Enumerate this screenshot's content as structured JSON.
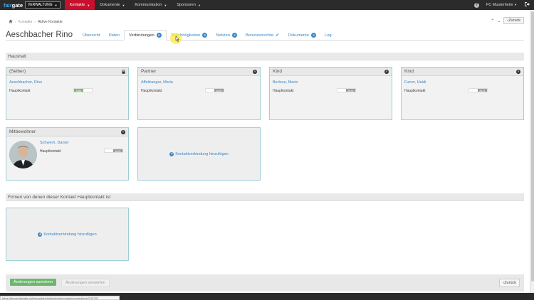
{
  "topbar": {
    "logo_part1": "fair",
    "logo_part2": "gate",
    "workspace": "VERWALTUNG",
    "nav": [
      {
        "label": "Kontakte",
        "active": true
      },
      {
        "label": "Dokumente"
      },
      {
        "label": "Kommunikation"
      },
      {
        "label": "Sponsoren"
      }
    ],
    "club": "FC Musterheim"
  },
  "breadcrumb": {
    "home": "Kontakte",
    "current": "Aktive Kontakte"
  },
  "back_label": "Zurück",
  "page_title": "Aeschbacher Rino",
  "tabs": [
    {
      "label": "Übersicht"
    },
    {
      "label": "Daten"
    },
    {
      "label": "Verbindungen",
      "badge": "6",
      "active": true
    },
    {
      "label": "Zugehörigkeiten",
      "badge": "5"
    },
    {
      "label": "Notizen",
      "badge": "2"
    },
    {
      "label": "Benutzerrechte",
      "check": true
    },
    {
      "label": "Dokumente",
      "badge": "2"
    },
    {
      "label": "Log"
    }
  ],
  "household": {
    "title": "Haushalt",
    "cards": [
      {
        "role": "(Selber)",
        "name": "Aeschbacher, Rino",
        "label": "Hauptkontakt",
        "state": "EIN",
        "icon": "lock-icon"
      },
      {
        "role": "Partner",
        "name": "Affeltranger, Maria",
        "label": "Hauptkontakt",
        "state": "AUS",
        "icon": "close-icon"
      },
      {
        "role": "Kind",
        "name": "Berlese, Mario",
        "label": "Hauptkontakt",
        "state": "AUS",
        "icon": "close-icon"
      },
      {
        "role": "Kind",
        "name": "Furrer, Heidi",
        "label": "Hauptkontakt",
        "state": "AUS",
        "icon": "close-icon"
      },
      {
        "role": "Mitbewohner",
        "name": "Schwerri, Daniel",
        "label": "Hauptkontakt",
        "state": "AUS",
        "icon": "close-icon"
      }
    ],
    "add_label": "Kontaktverbindung hinzufügen"
  },
  "companies": {
    "title": "Firmen von denen dieser Kontakt Hauptkontakt ist",
    "add_label": "Kontaktverbindung hinzufügen"
  },
  "footer": {
    "save": "Änderungen speichern",
    "discard": "Änderungen verwerfen",
    "back": "Zurück"
  },
  "statusbar": "https://demo.fairgate.ch/fcmusterheim/backend/contact/connections/7/12797"
}
